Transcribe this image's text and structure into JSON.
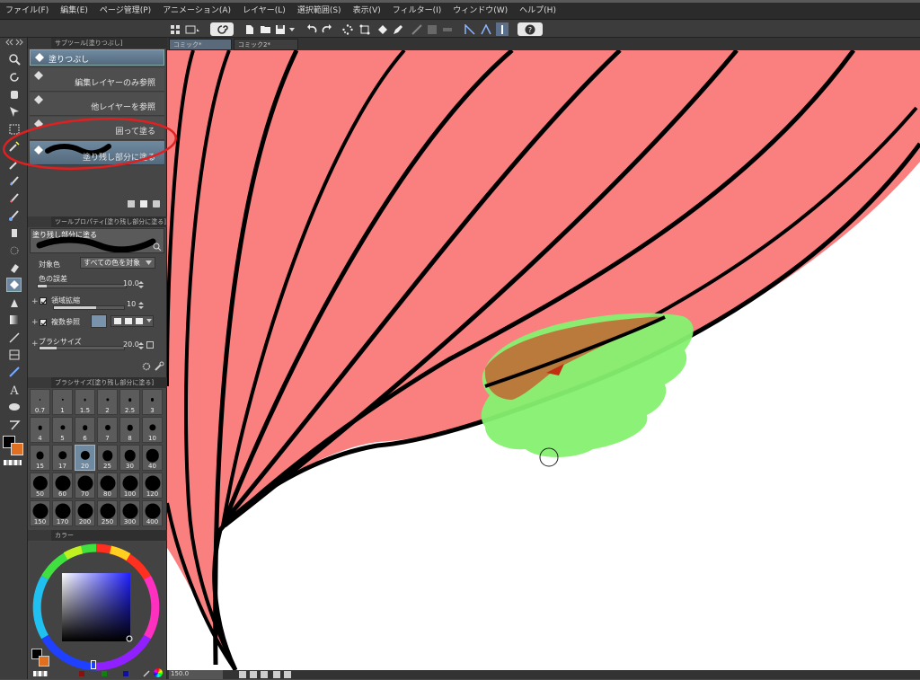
{
  "menu": {
    "items": [
      "ファイル(F)",
      "編集(E)",
      "ページ管理(P)",
      "アニメーション(A)",
      "レイヤー(L)",
      "選択範囲(S)",
      "表示(V)",
      "フィルター(I)",
      "ウィンドウ(W)",
      "ヘルプ(H)"
    ]
  },
  "document_tabs": [
    "コミック*",
    "コミック2*"
  ],
  "subtool_panel": {
    "header": "サブツール[塗りつぶし]",
    "group": "塗りつぶし",
    "items": [
      {
        "label": "編集レイヤーのみ参照",
        "selected": false
      },
      {
        "label": "他レイヤーを参照",
        "selected": false
      },
      {
        "label": "囲って塗る",
        "selected": false
      },
      {
        "label": "塗り残し部分に塗る",
        "selected": true
      }
    ]
  },
  "tool_property": {
    "header": "ツールプロパティ[塗り残し部分に塗る]",
    "tool_name": "塗り残し部分に塗る",
    "target_color_label": "対象色",
    "target_color_value": "すべての色を対象",
    "color_margin_label": "色の誤差",
    "color_margin_value": "10.0",
    "color_margin_fraction": 0.1,
    "area_scaling_label": "領域拡縮",
    "area_scaling_value": "10",
    "area_scaling_fraction": 0.6,
    "multi_ref_label": "複数参照",
    "brush_size_label": "ブラシサイズ",
    "brush_size_value": "20.0",
    "brush_size_fraction": 0.2
  },
  "brush_size_panel": {
    "header": "ブラシサイズ[塗り残し部分に塗る]",
    "sizes": [
      "0.7",
      "1",
      "1.5",
      "2",
      "2.5",
      "3",
      "4",
      "5",
      "6",
      "7",
      "8",
      "10",
      "15",
      "17",
      "20",
      "25",
      "30",
      "40",
      "50",
      "60",
      "70",
      "80",
      "100",
      "120",
      "150",
      "170",
      "200",
      "250",
      "300",
      "400"
    ],
    "selected": "20"
  },
  "color_panel": {
    "header": "カラー",
    "main_color": "#000000",
    "sub_color": "#e07020"
  },
  "status": {
    "zoom": "150.0"
  },
  "colors": {
    "fill_pink": "#fa8080",
    "fill_green": "#86f070",
    "fill_brown": "#b97a3c",
    "line": "#000000",
    "annotation_red": "#e02020"
  }
}
